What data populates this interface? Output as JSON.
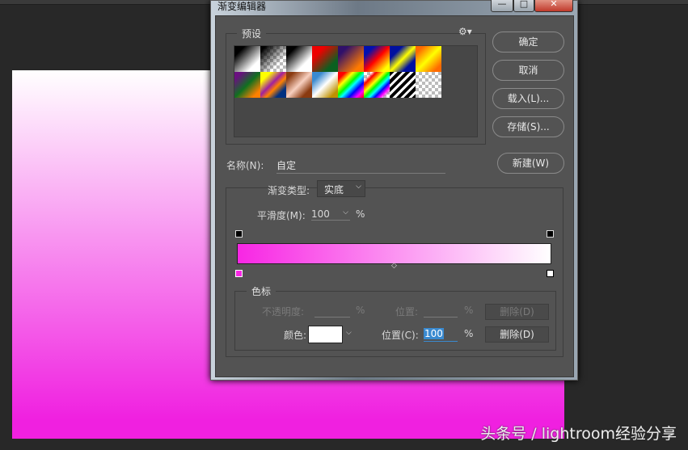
{
  "dialog": {
    "title": "渐变编辑器",
    "min_icon": "minimize-icon",
    "max_icon": "maximize-icon",
    "close_icon": "close-icon"
  },
  "presets": {
    "label": "预设",
    "gear_icon": "gear-icon",
    "swatches": [
      "黑白",
      "透明到黑",
      "黑白2",
      "红绿",
      "紫橙",
      "蓝红黄",
      "蓝黄蓝",
      "橙黄橙",
      "紫绿橙",
      "黄紫橙蓝",
      "铜色",
      "铬黄",
      "色谱",
      "透明彩虹",
      "透明条纹",
      "透明"
    ]
  },
  "buttons": {
    "ok": "确定",
    "cancel": "取消",
    "load": "载入(L)...",
    "save": "存储(S)...",
    "new": "新建(W)"
  },
  "name": {
    "label": "名称(N):",
    "value": "自定"
  },
  "gradient": {
    "type_label": "渐变类型:",
    "type_value": "实底",
    "smooth_label": "平滑度(M):",
    "smooth_value": "100",
    "pct": "%",
    "start_color": "#f826e4",
    "end_color": "#ffffff"
  },
  "stops": {
    "label": "色标",
    "opacity_label": "不透明度:",
    "opacity_pct": "%",
    "opacity_pos_label": "位置:",
    "opacity_pos_pct": "%",
    "opacity_delete": "删除(D)",
    "color_label": "颜色:",
    "color_value": "#ffffff",
    "color_pos_label": "位置(C):",
    "color_pos_value": "100",
    "color_pos_pct": "%",
    "color_delete": "删除(D)"
  },
  "watermark": "头条号 / lightroom经验分享"
}
